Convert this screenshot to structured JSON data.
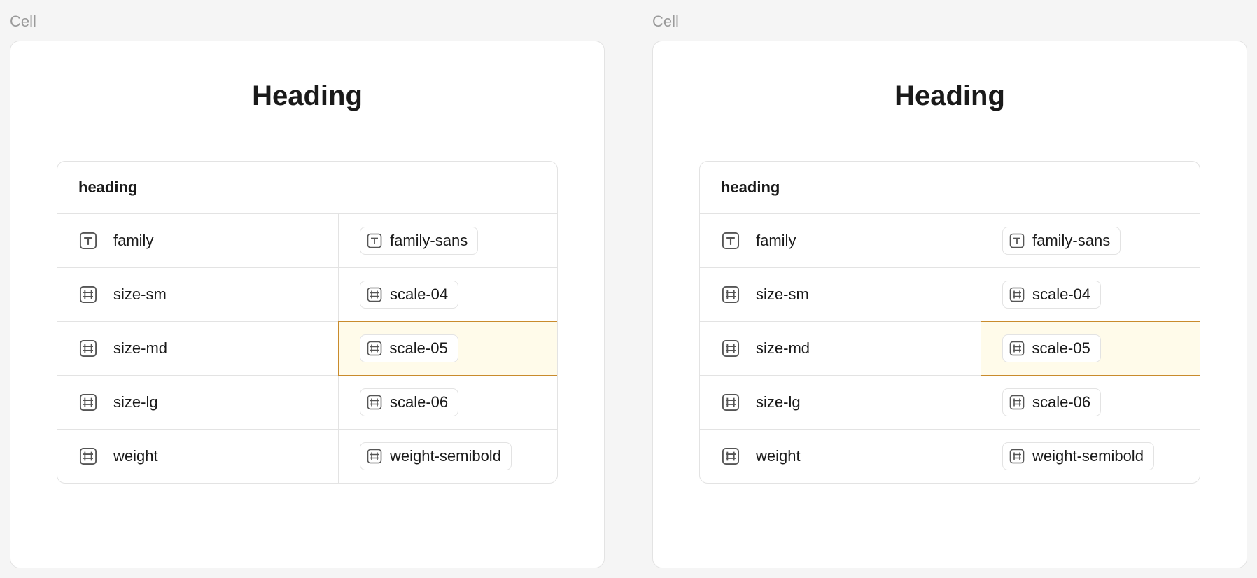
{
  "cells": [
    {
      "label": "Cell",
      "title": "Heading",
      "group_name": "heading",
      "rows": [
        {
          "key_icon": "text",
          "key": "family",
          "value_icon": "text",
          "value": "family-sans",
          "highlighted": false
        },
        {
          "key_icon": "hash",
          "key": "size-sm",
          "value_icon": "hash",
          "value": "scale-04",
          "highlighted": false
        },
        {
          "key_icon": "hash",
          "key": "size-md",
          "value_icon": "hash",
          "value": "scale-05",
          "highlighted": true
        },
        {
          "key_icon": "hash",
          "key": "size-lg",
          "value_icon": "hash",
          "value": "scale-06",
          "highlighted": false
        },
        {
          "key_icon": "hash",
          "key": "weight",
          "value_icon": "hash",
          "value": "weight-semibold",
          "highlighted": false
        }
      ]
    },
    {
      "label": "Cell",
      "title": "Heading",
      "group_name": "heading",
      "rows": [
        {
          "key_icon": "text",
          "key": "family",
          "value_icon": "text",
          "value": "family-sans",
          "highlighted": false
        },
        {
          "key_icon": "hash",
          "key": "size-sm",
          "value_icon": "hash",
          "value": "scale-04",
          "highlighted": false
        },
        {
          "key_icon": "hash",
          "key": "size-md",
          "value_icon": "hash",
          "value": "scale-05",
          "highlighted": true
        },
        {
          "key_icon": "hash",
          "key": "size-lg",
          "value_icon": "hash",
          "value": "scale-06",
          "highlighted": false
        },
        {
          "key_icon": "hash",
          "key": "weight",
          "value_icon": "hash",
          "value": "weight-semibold",
          "highlighted": false
        }
      ]
    }
  ]
}
